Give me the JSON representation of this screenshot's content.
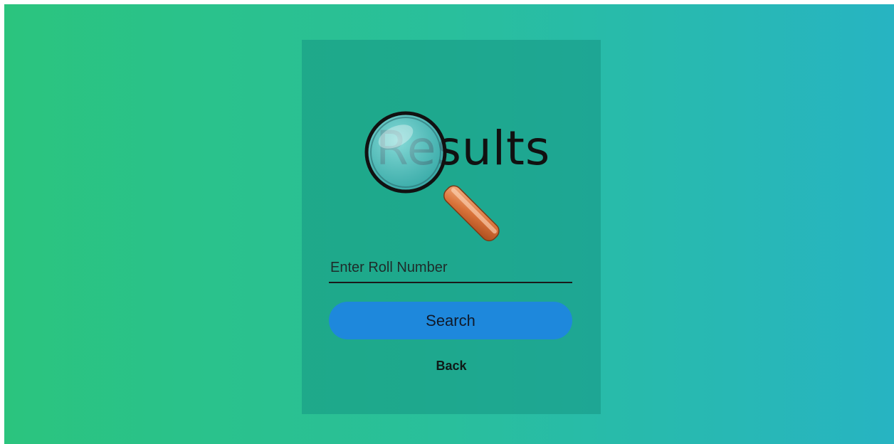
{
  "logo": {
    "word": "Results",
    "icon": "magnifying-glass-icon"
  },
  "form": {
    "roll_placeholder": "Enter Roll Number",
    "roll_value": "",
    "search_label": "Search",
    "back_label": "Back"
  },
  "colors": {
    "background_left": "#2bc47e",
    "background_right": "#27b4c2",
    "card": "#22a88f",
    "button": "#1e88dc"
  }
}
